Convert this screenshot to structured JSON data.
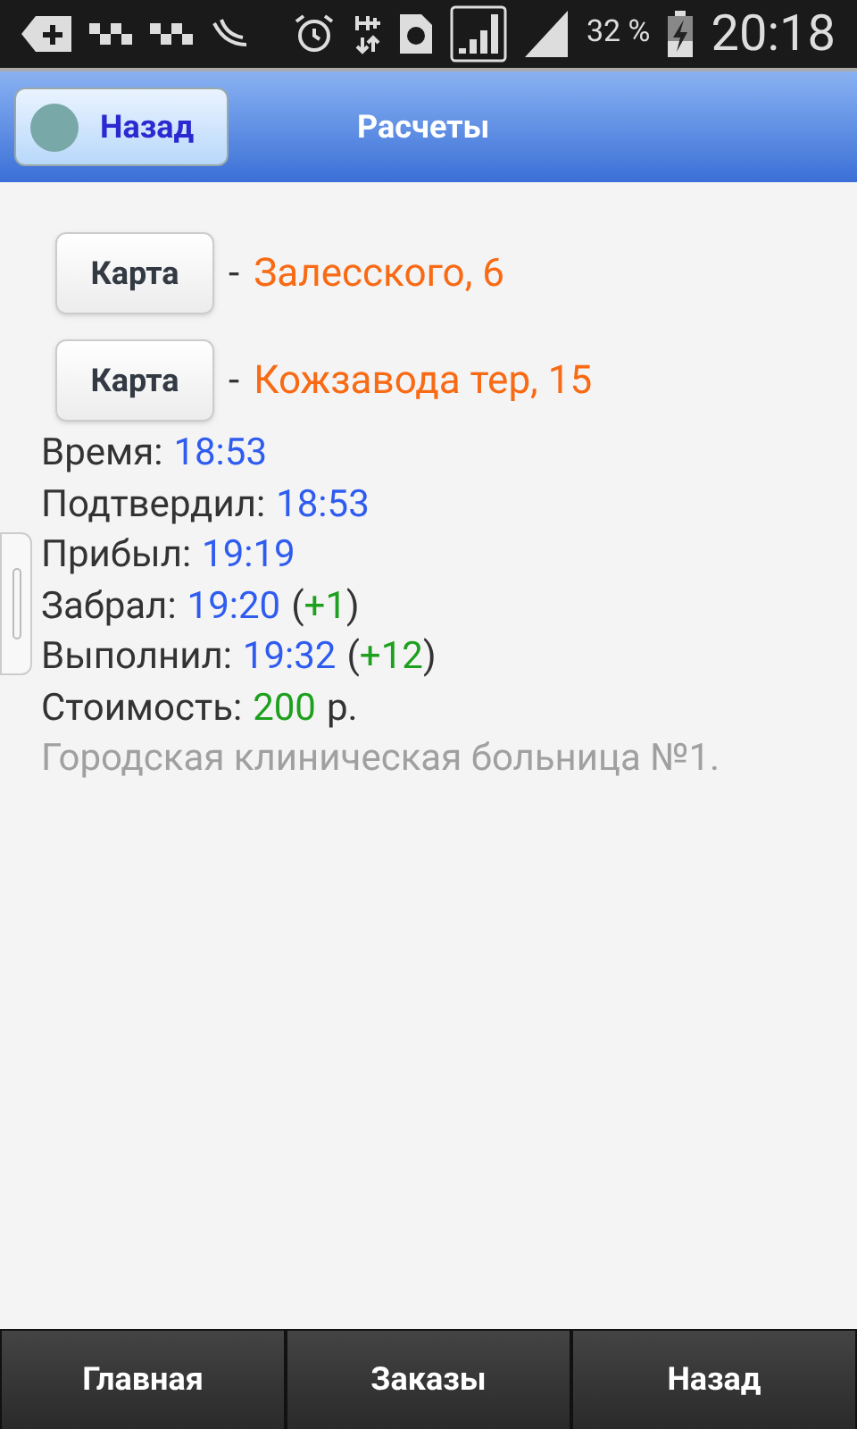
{
  "status_bar": {
    "battery": "32 %",
    "time": "20:18"
  },
  "header": {
    "back_button": "Назад",
    "title": "Расчеты"
  },
  "addresses": [
    {
      "button": "Карта",
      "dash": "-",
      "address": "Залесского, 6"
    },
    {
      "button": "Карта",
      "dash": "-",
      "address": "Кожзавода тер, 15"
    }
  ],
  "details": [
    [
      {
        "kind": "label",
        "text": "Время:"
      },
      {
        "kind": "time",
        "text": "18:53"
      }
    ],
    [
      {
        "kind": "label",
        "text": "Подтвердил:"
      },
      {
        "kind": "time",
        "text": "18:53"
      }
    ],
    [
      {
        "kind": "label",
        "text": "Прибыл:"
      },
      {
        "kind": "time",
        "text": "19:19"
      }
    ],
    [
      {
        "kind": "label",
        "text": "Забрал:"
      },
      {
        "kind": "time",
        "text": "19:20"
      },
      {
        "kind": "delta",
        "open": "(",
        "text": "+1",
        "close": ")"
      }
    ],
    [
      {
        "kind": "label",
        "text": "Выполнил:"
      },
      {
        "kind": "time",
        "text": "19:32"
      },
      {
        "kind": "delta",
        "open": "(",
        "text": "+12",
        "close": ")"
      }
    ],
    [
      {
        "kind": "label",
        "text": "Стоимость:"
      },
      {
        "kind": "money",
        "text": "200"
      },
      {
        "kind": "label",
        "text": "р."
      }
    ]
  ],
  "note": "Городская клиническая больница №1.",
  "bottom_nav": [
    "Главная",
    "Заказы",
    "Назад"
  ]
}
